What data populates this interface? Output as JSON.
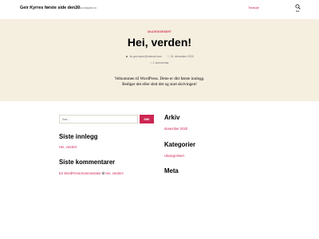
{
  "header": {
    "site_title": "Geir Kyrres første side den20",
    "site_desc": "www.udapost.no",
    "nav_link": "Testside",
    "search_label": "Søk"
  },
  "post": {
    "category": "UKATEGORISERT",
    "title": "Hei, verden!",
    "author": "Av geir.kyrre@hotmail.com",
    "date": "31. desember 2020",
    "comments": "1 kommentar",
    "body_line1": "Velkommen til WordPress. Dette er ditt første innlegg.",
    "body_line2": "Rediger det eller slett det og start skrivingen!"
  },
  "widgets": {
    "search_placeholder": "Søk ...",
    "search_button": "SØK",
    "recent_posts_title": "Siste innlegg",
    "recent_posts": [
      "Hei, verden!"
    ],
    "recent_comments_title": "Siste kommentarer",
    "recent_comment_author": "En WordPress-kommentator",
    "recent_comment_joiner": "til",
    "recent_comment_post": "Hei, verden!",
    "archive_title": "Arkiv",
    "archive_items": [
      "desember 2020"
    ],
    "categories_title": "Kategorier",
    "categories_items": [
      "Ukategorisert"
    ],
    "meta_title": "Meta"
  },
  "colors": {
    "accent": "#cd2653",
    "hero_bg": "#f5efe0"
  }
}
